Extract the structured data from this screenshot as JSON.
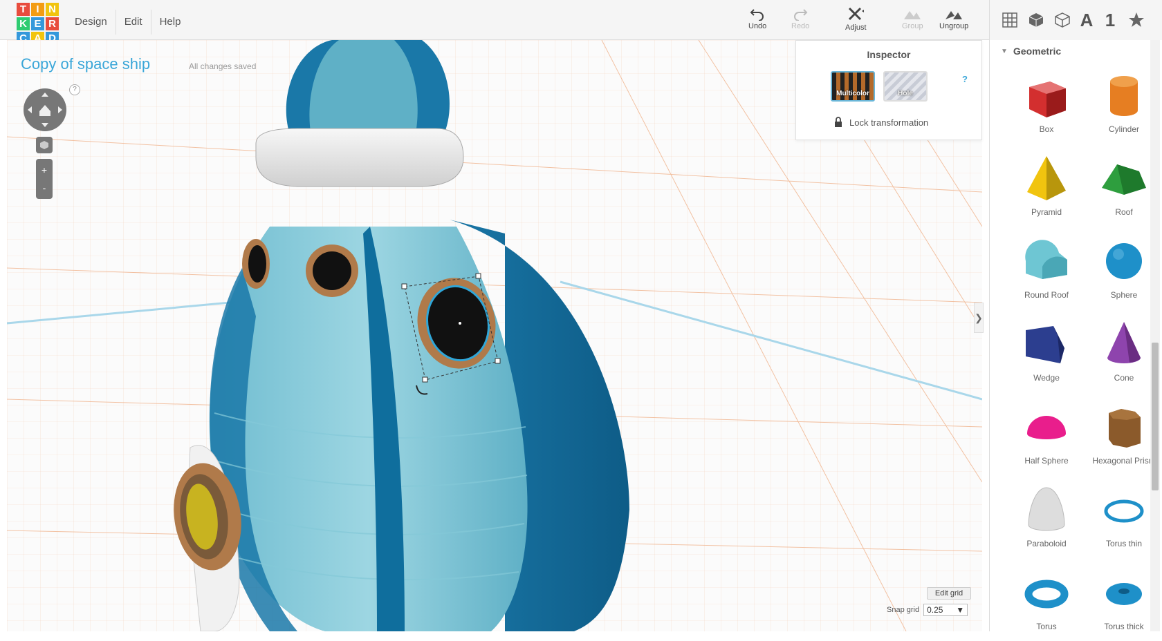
{
  "logo": {
    "letters": [
      "T",
      "I",
      "N",
      "K",
      "E",
      "R",
      "C",
      "A",
      "D"
    ],
    "colors": [
      "#e84c3d",
      "#f39c12",
      "#f1c40f",
      "#2ecc71",
      "#3498db",
      "#e84c3d",
      "#3498db",
      "#f1c40f",
      "#3498db"
    ]
  },
  "menu": {
    "design": "Design",
    "edit": "Edit",
    "help": "Help"
  },
  "toolbar": {
    "undo": "Undo",
    "redo": "Redo",
    "adjust": "Adjust",
    "group": "Group",
    "ungroup": "Ungroup"
  },
  "view_tabs": {
    "text_tab": "A",
    "number_tab": "1"
  },
  "project": {
    "title": "Copy of space ship",
    "save_status": "All changes saved"
  },
  "nav": {
    "help": "?",
    "zoom_in": "+",
    "zoom_out": "-"
  },
  "inspector": {
    "title": "Inspector",
    "multicolor": "Multicolor",
    "hole": "Hole",
    "help": "?",
    "lock": "Lock transformation"
  },
  "grid": {
    "edit_grid": "Edit grid",
    "snap_label": "Snap grid",
    "snap_value": "0.25"
  },
  "sidebar": {
    "category": "Geometric",
    "shapes": [
      {
        "label": "Box",
        "icon": "box-icon",
        "color": "#d32f2f"
      },
      {
        "label": "Cylinder",
        "icon": "cylinder-icon",
        "color": "#e67e22"
      },
      {
        "label": "Pyramid",
        "icon": "pyramid-icon",
        "color": "#f1c40f"
      },
      {
        "label": "Roof",
        "icon": "roof-icon",
        "color": "#2e9e3e"
      },
      {
        "label": "Round Roof",
        "icon": "round-roof-icon",
        "color": "#6ec6d3"
      },
      {
        "label": "Sphere",
        "icon": "sphere-icon",
        "color": "#1e90c9"
      },
      {
        "label": "Wedge",
        "icon": "wedge-icon",
        "color": "#2c3e8f"
      },
      {
        "label": "Cone",
        "icon": "cone-icon",
        "color": "#8e44ad"
      },
      {
        "label": "Half Sphere",
        "icon": "half-sphere-icon",
        "color": "#e91e8c"
      },
      {
        "label": "Hexagonal Prism",
        "icon": "hexagonal-prism-icon",
        "color": "#8b5a2b"
      },
      {
        "label": "Paraboloid",
        "icon": "paraboloid-icon",
        "color": "#dddddd"
      },
      {
        "label": "Torus thin",
        "icon": "torus-thin-icon",
        "color": "#1e90c9"
      },
      {
        "label": "Torus",
        "icon": "torus-icon",
        "color": "#1e90c9"
      },
      {
        "label": "Torus thick",
        "icon": "torus-thick-icon",
        "color": "#1e90c9"
      }
    ]
  }
}
